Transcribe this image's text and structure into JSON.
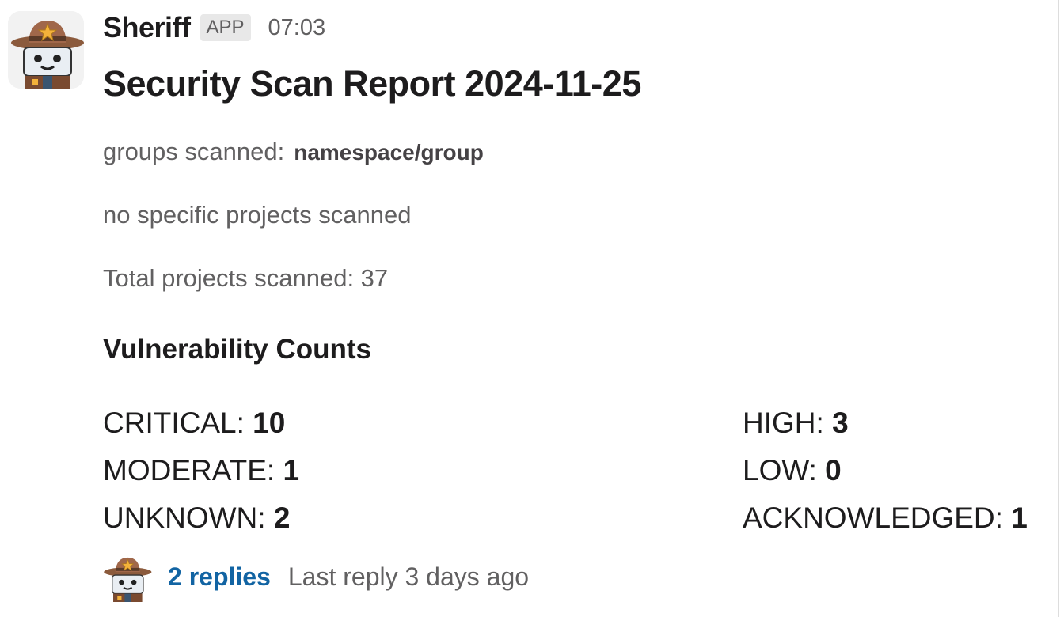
{
  "message": {
    "sender": "Sheriff",
    "badge": "APP",
    "time": "07:03",
    "avatar_icon": "sheriff-robot-cowboy-icon",
    "title": "Security Scan Report 2024-11-25",
    "groups_label": "groups scanned:",
    "groups_value": "namespace/group",
    "projects_line": "no specific projects scanned",
    "total_line": "Total projects scanned: 37",
    "section_heading": "Vulnerability Counts",
    "counts": [
      {
        "label": "CRITICAL: ",
        "value": "10"
      },
      {
        "label": "HIGH: ",
        "value": "3"
      },
      {
        "label": "MODERATE: ",
        "value": "1"
      },
      {
        "label": "LOW: ",
        "value": "0"
      },
      {
        "label": "UNKNOWN: ",
        "value": "2"
      },
      {
        "label": "ACKNOWLEDGED: ",
        "value": "1"
      }
    ]
  },
  "thread": {
    "replies_label": "2 replies",
    "last_reply": "Last reply 3 days ago"
  },
  "colors": {
    "link": "#1264a3",
    "muted": "#616061",
    "text": "#1d1c1d",
    "hat": "#8b5a3c",
    "star": "#f4b23a"
  }
}
